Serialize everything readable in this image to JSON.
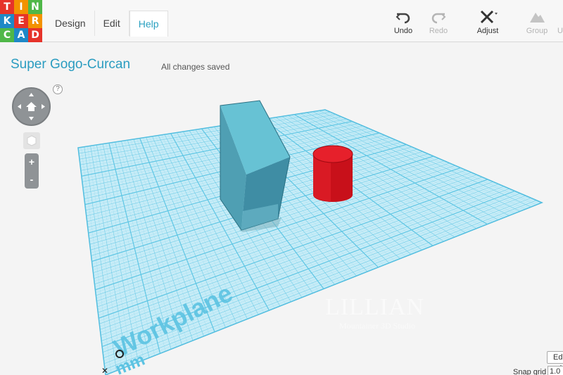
{
  "logo": {
    "letters": [
      "T",
      "I",
      "N",
      "K",
      "E",
      "R",
      "C",
      "A",
      "D"
    ],
    "colors": [
      "#e6332a",
      "#f39200",
      "#4fb748",
      "#1e88c7",
      "#e6332a",
      "#f39200",
      "#4fb748",
      "#1e88c7",
      "#e6332a"
    ]
  },
  "menu": {
    "items": [
      {
        "label": "Design"
      },
      {
        "label": "Edit"
      },
      {
        "label": "Help"
      }
    ]
  },
  "toolbar": {
    "undo": "Undo",
    "redo": "Redo",
    "adjust": "Adjust",
    "group": "Group",
    "ungroup_partial": "U"
  },
  "document": {
    "title": "Super Gogo-Curcan",
    "save_status": "All changes saved"
  },
  "nav": {
    "help": "?",
    "zoom_in": "+",
    "zoom_out": "-"
  },
  "workplane": {
    "label": "Workplane",
    "unit": "mm",
    "grid_color": "#5fc6e4",
    "plane_color": "#bfe9f6"
  },
  "objects": [
    {
      "name": "box",
      "color": "#5fb8cc"
    },
    {
      "name": "cylinder",
      "color": "#d6141e"
    }
  ],
  "watermark": {
    "title": "LILLIAN",
    "subtitle": "Mountainer 3D Studio"
  },
  "bottom": {
    "edit_grid": "Edit grid",
    "snap_label": "Snap grid",
    "snap_value": "1.0"
  }
}
